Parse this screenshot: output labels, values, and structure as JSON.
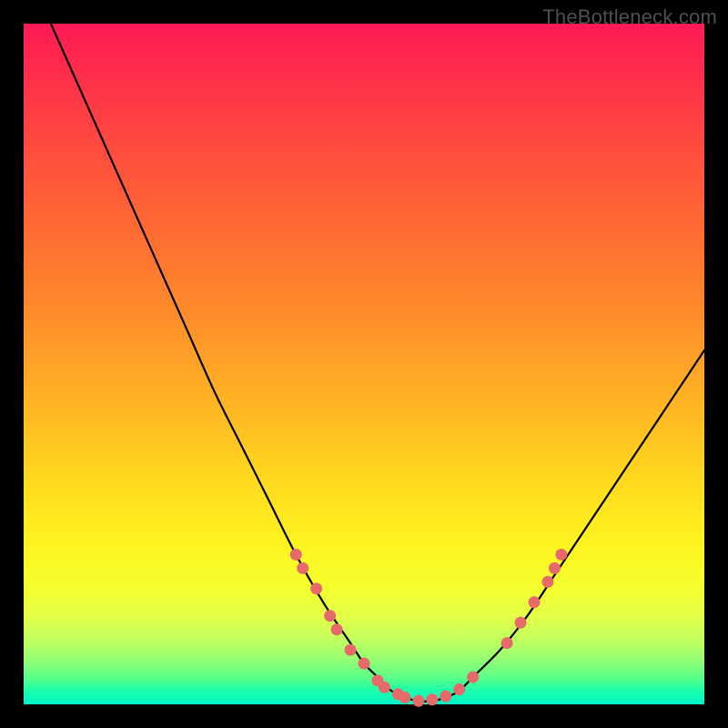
{
  "watermark": "TheBottleneck.com",
  "axes": {
    "x_range": [
      0,
      100
    ],
    "y_range": [
      0,
      100
    ],
    "xlabel": "",
    "ylabel": ""
  },
  "chart_data": {
    "type": "line",
    "title": "",
    "xlabel": "",
    "ylabel": "",
    "xlim": [
      0,
      100
    ],
    "ylim": [
      0,
      100
    ],
    "series": [
      {
        "name": "bottleneck-curve",
        "x": [
          4,
          8,
          12,
          16,
          20,
          24,
          28,
          32,
          36,
          40,
          44,
          48,
          50,
          52,
          54,
          56,
          58,
          60,
          62,
          64,
          66,
          70,
          74,
          78,
          82,
          86,
          90,
          94,
          98,
          100
        ],
        "y": [
          100,
          91,
          82,
          73,
          64,
          55,
          46,
          38,
          30,
          22,
          15,
          9,
          6,
          4,
          2,
          1,
          0.5,
          0.5,
          1,
          2,
          4,
          8,
          13,
          19,
          25,
          31,
          37,
          43,
          49,
          52
        ]
      }
    ],
    "markers": [
      {
        "name": "highlight-dots",
        "color": "#e66a6a",
        "points": [
          {
            "x": 40,
            "y": 22
          },
          {
            "x": 41,
            "y": 20
          },
          {
            "x": 43,
            "y": 17
          },
          {
            "x": 45,
            "y": 13
          },
          {
            "x": 46,
            "y": 11
          },
          {
            "x": 48,
            "y": 8
          },
          {
            "x": 50,
            "y": 6
          },
          {
            "x": 52,
            "y": 3.5
          },
          {
            "x": 53,
            "y": 2.5
          },
          {
            "x": 55,
            "y": 1.5
          },
          {
            "x": 56,
            "y": 1
          },
          {
            "x": 58,
            "y": 0.5
          },
          {
            "x": 60,
            "y": 0.7
          },
          {
            "x": 62,
            "y": 1.2
          },
          {
            "x": 64,
            "y": 2.2
          },
          {
            "x": 66,
            "y": 4
          },
          {
            "x": 71,
            "y": 9
          },
          {
            "x": 73,
            "y": 12
          },
          {
            "x": 75,
            "y": 15
          },
          {
            "x": 77,
            "y": 18
          },
          {
            "x": 78,
            "y": 20
          },
          {
            "x": 79,
            "y": 22
          }
        ]
      }
    ]
  }
}
